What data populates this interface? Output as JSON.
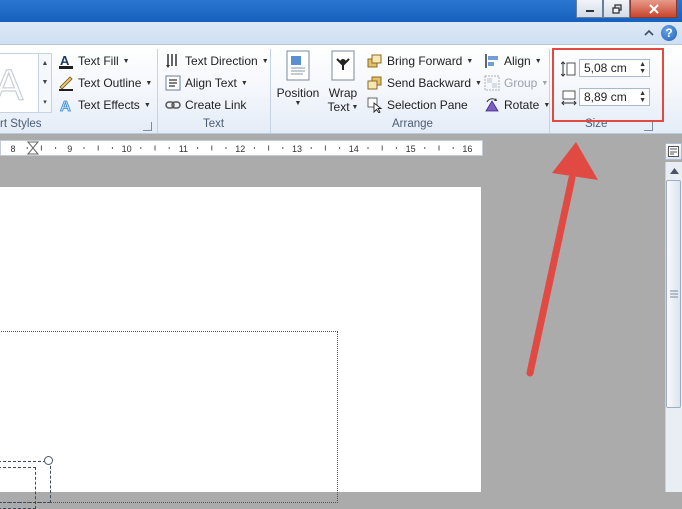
{
  "window": {
    "controls": [
      "minimize-icon",
      "restore-icon",
      "close-icon"
    ],
    "help_icon": "help-icon",
    "collapse_icon": "chevron-up-icon"
  },
  "ribbon": {
    "wordart_styles": {
      "group_label": "rt Styles",
      "text_fill": "Text Fill",
      "text_outline": "Text Outline",
      "text_effects": "Text Effects"
    },
    "text": {
      "group_label": "Text",
      "text_direction": "Text Direction",
      "align_text": "Align Text",
      "create_link": "Create Link"
    },
    "arrange": {
      "group_label": "Arrange",
      "position": "Position",
      "wrap_text_line1": "Wrap",
      "wrap_text_line2": "Text",
      "bring_forward": "Bring Forward",
      "send_backward": "Send Backward",
      "selection_pane": "Selection Pane",
      "align": "Align",
      "group": "Group",
      "rotate": "Rotate"
    },
    "size": {
      "group_label": "Size",
      "height_value": "5,08 cm",
      "width_value": "8,89 cm"
    }
  },
  "ruler": {
    "labels": [
      "8",
      "9",
      "10",
      "11",
      "12",
      "13",
      "14",
      "15",
      "16"
    ]
  },
  "colors": {
    "highlight": "#e04a43",
    "arrow": "#e04a43",
    "accent": "#2a76cf"
  }
}
